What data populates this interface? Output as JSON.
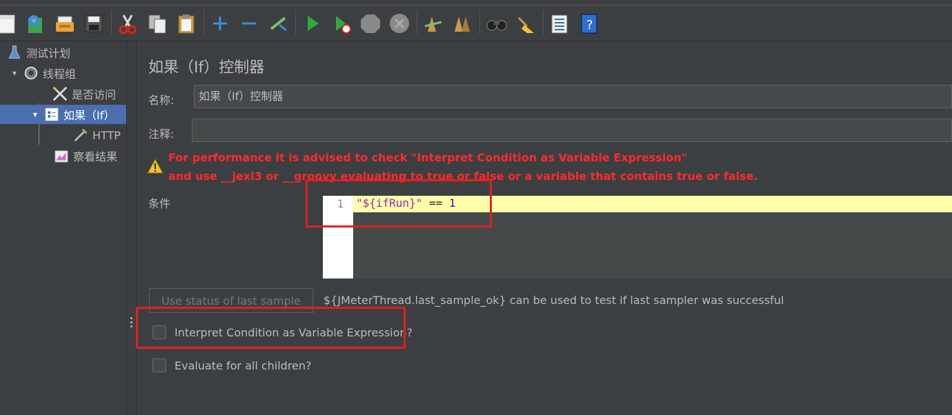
{
  "toolbar": {
    "buttons": [
      {
        "name": "new-icon"
      },
      {
        "name": "templates-icon"
      },
      {
        "name": "open-icon"
      },
      {
        "name": "save-icon"
      },
      {
        "name": "cut-icon"
      },
      {
        "name": "copy-icon"
      },
      {
        "name": "paste-icon"
      },
      {
        "name": "expand-icon"
      },
      {
        "name": "collapse-icon"
      },
      {
        "name": "toggle-icon"
      },
      {
        "name": "start-icon"
      },
      {
        "name": "start-no-pauses-icon"
      },
      {
        "name": "stop-icon"
      },
      {
        "name": "shutdown-icon"
      },
      {
        "name": "clear-icon"
      },
      {
        "name": "clear-all-icon"
      },
      {
        "name": "search-icon"
      },
      {
        "name": "reset-search-icon"
      },
      {
        "name": "function-helper-icon"
      },
      {
        "name": "help-icon"
      }
    ]
  },
  "tree": {
    "items": [
      {
        "label": "测试计划",
        "icon": "test-plan-icon"
      },
      {
        "label": "线程组",
        "icon": "thread-group-icon"
      },
      {
        "label": "是否访问",
        "icon": "config-tools-icon"
      },
      {
        "label": "如果（If）",
        "icon": "if-controller-icon"
      },
      {
        "label": "HTTP",
        "icon": "http-sampler-icon"
      },
      {
        "label": "察看结果",
        "icon": "results-tree-icon"
      }
    ]
  },
  "main": {
    "title": "如果（If）控制器",
    "name_label": "名称:",
    "name_value": "如果（If）控制器",
    "comment_label": "注释:",
    "comment_value": "",
    "warning_line1": "For performance it is advised to check \"Interpret Condition as Variable Expression\"",
    "warning_line2": "and use __jexl3 or __groovy evaluating to true or false or a variable that contains true or false.",
    "condition_label": "条件",
    "editor": {
      "line_number": "1",
      "code_string": "\"${ifRun}\"",
      "code_op": " == ",
      "code_num": "1"
    },
    "use_status_button": "Use status of last sample",
    "hint_text": "${JMeterThread.last_sample_ok} can be used to test if last sampler was successful",
    "checkbox_interpret": "Interpret Condition as Variable Expression?",
    "checkbox_evaluate": "Evaluate for all children?"
  },
  "colors": {
    "background": "#3c3f41",
    "selection": "#4b6eaf",
    "warning": "#ff2a2a",
    "annotation": "#e0211e",
    "current_line": "#ffffaa"
  }
}
